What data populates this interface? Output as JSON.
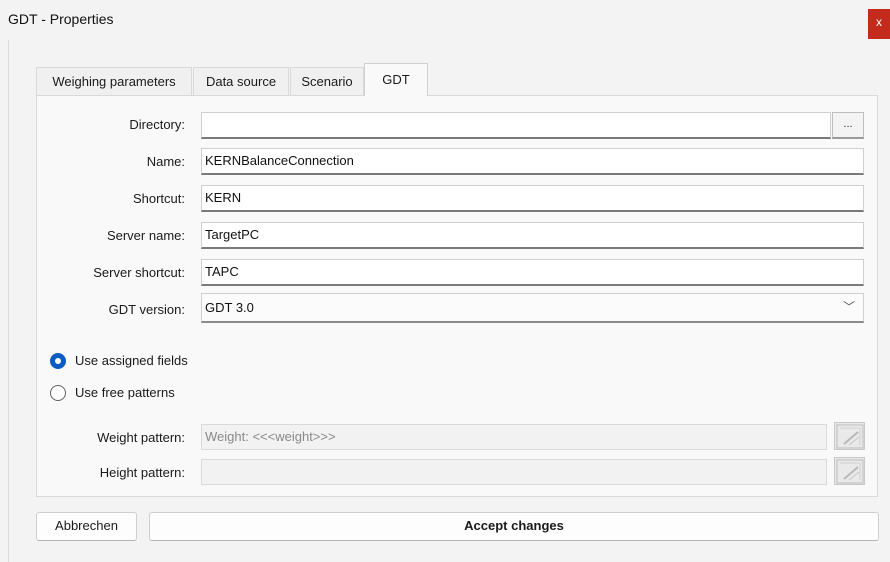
{
  "window": {
    "title": "GDT - Properties",
    "close_glyph": "x"
  },
  "tabs": [
    {
      "label": "Weighing parameters",
      "active": false
    },
    {
      "label": "Data source",
      "active": false
    },
    {
      "label": "Scenario",
      "active": false
    },
    {
      "label": "GDT",
      "active": true
    }
  ],
  "form": {
    "directory": {
      "label": "Directory:",
      "value": "",
      "browse_label": "..."
    },
    "name": {
      "label": "Name:",
      "value": "KERNBalanceConnection"
    },
    "shortcut": {
      "label": "Shortcut:",
      "value": "KERN"
    },
    "server_name": {
      "label": "Server name:",
      "value": "TargetPC"
    },
    "server_shortcut": {
      "label": "Server shortcut:",
      "value": "TAPC"
    },
    "gdt_version": {
      "label": "GDT version:",
      "value": "GDT 3.0",
      "chevron": "﹀"
    }
  },
  "options": {
    "assigned": {
      "label": "Use assigned fields",
      "selected": true
    },
    "free": {
      "label": "Use free patterns",
      "selected": false
    }
  },
  "patterns": {
    "weight": {
      "label": "Weight pattern:",
      "value": "Weight: <<<weight>>>",
      "icon": "edit-pattern-icon"
    },
    "height": {
      "label": "Height pattern:",
      "value": "",
      "icon": "edit-pattern-icon"
    }
  },
  "buttons": {
    "cancel": "Abbrechen",
    "accept": "Accept changes"
  },
  "colors": {
    "radio_accent": "#0a5bc4",
    "close_bg": "#c42b1c"
  }
}
